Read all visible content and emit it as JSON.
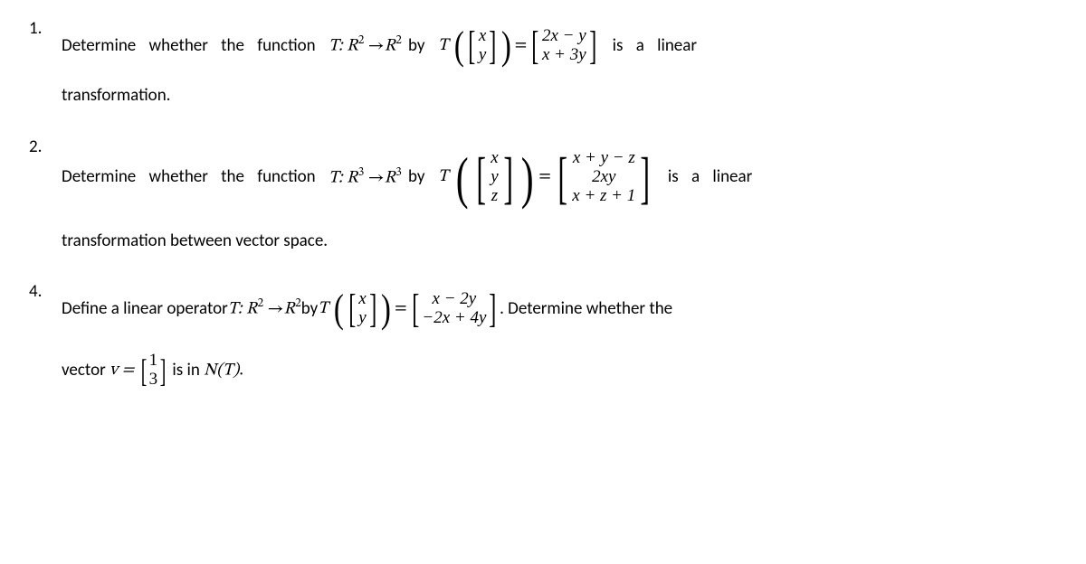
{
  "problems": [
    {
      "num": "1.",
      "text_before": "Determine  whether  the  function  ",
      "tdef": {
        "name": "T:",
        "from": "R",
        "fromsup": "2",
        "arrow": " →",
        "to": "R",
        "tosup": "2"
      },
      "by": " by  ",
      "T": "T",
      "input": {
        "rows": [
          "x",
          "y"
        ],
        "size": 2
      },
      "eq": " = ",
      "output": {
        "rows": [
          "2x − y",
          "x + 3y"
        ],
        "size": 2
      },
      "text_after": "  is  a  linear",
      "line2": "transformation."
    },
    {
      "num": "2.",
      "text_before": "Determine  whether  the  function  ",
      "tdef": {
        "name": "T:",
        "from": "R",
        "fromsup": "3",
        "arrow": " →",
        "to": "R",
        "tosup": "3"
      },
      "by": " by  ",
      "T": "T",
      "input": {
        "rows": [
          "x",
          "y",
          "z"
        ],
        "size": 3
      },
      "eq": " = ",
      "output": {
        "rows": [
          "x + y − z",
          "2xy",
          "x + z + 1"
        ],
        "size": 3
      },
      "text_after": "  is  a  linear",
      "line2": "transformation between vector space."
    },
    {
      "num": "4.",
      "text_before": "Define a linear operator ",
      "tdef": {
        "name": "T:",
        "from": "R",
        "fromsup": "2",
        "arrow": " →",
        "to": "R",
        "tosup": "2"
      },
      "by": " by ",
      "T": "T",
      "input": {
        "rows": [
          "x",
          "y"
        ],
        "size": 2
      },
      "eq": " = ",
      "output": {
        "rows": [
          "x − 2y",
          "−2x + 4y"
        ],
        "size": 2
      },
      "text_after": ". Determine whether the",
      "line2_pre": "vector ",
      "veq": "v = ",
      "vecv": {
        "rows": [
          "1",
          "3"
        ],
        "size": 2
      },
      "line2_post": " is in ",
      "NT": "N(T)",
      "period": "."
    }
  ]
}
